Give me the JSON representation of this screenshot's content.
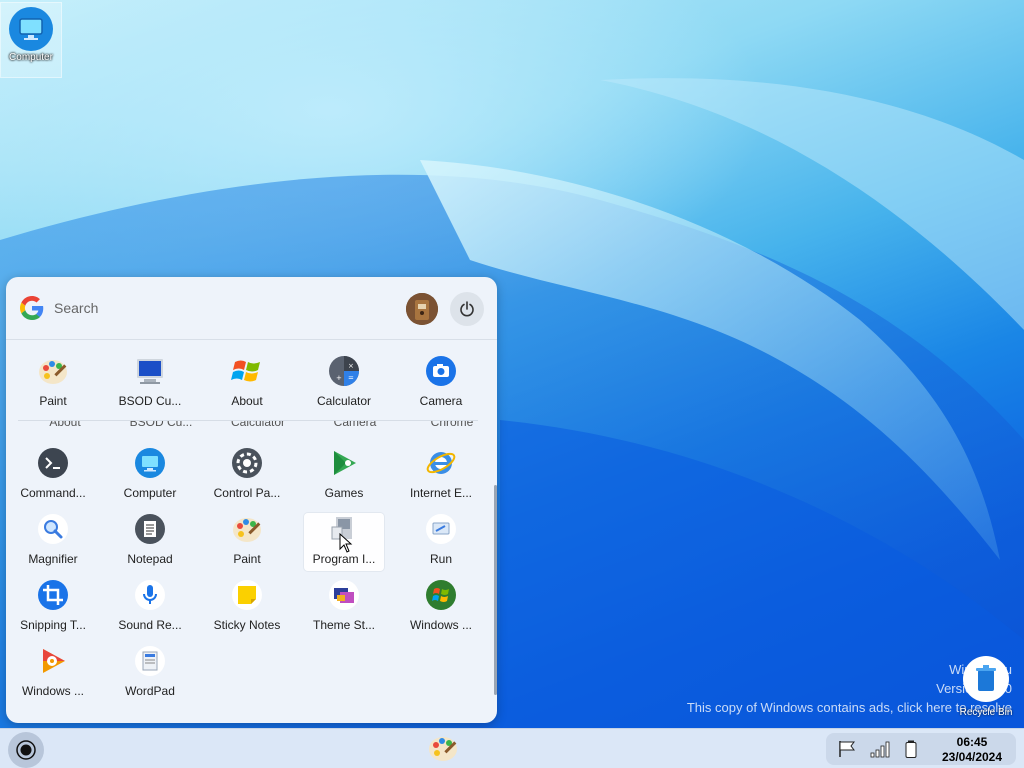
{
  "desktop": {
    "icon_label": "Computer",
    "recycle_label": "Recycle Bin",
    "watermark": {
      "line1": "Win7 Simu",
      "line2": "Version 3.9.0",
      "line3": "This copy of Windows contains ads, click here to resolve"
    }
  },
  "start_menu": {
    "search_placeholder": "Search",
    "pinned": [
      "Paint",
      "BSOD Cu...",
      "About",
      "Calculator",
      "Camera"
    ],
    "partially_hidden": [
      "About",
      "BSOD Cu...",
      "Calculator",
      "Camera",
      "Chrome"
    ],
    "apps": [
      [
        "Command...",
        "Computer",
        "Control Pa...",
        "Games",
        "Internet E..."
      ],
      [
        "Magnifier",
        "Notepad",
        "Paint",
        "Program I...",
        "Run"
      ],
      [
        "Snipping T...",
        "Sound Re...",
        "Sticky Notes",
        "Theme St...",
        "Windows ..."
      ],
      [
        "Windows ...",
        "WordPad"
      ]
    ]
  },
  "taskbar": {
    "time": "06:45",
    "date": "23/04/2024"
  }
}
